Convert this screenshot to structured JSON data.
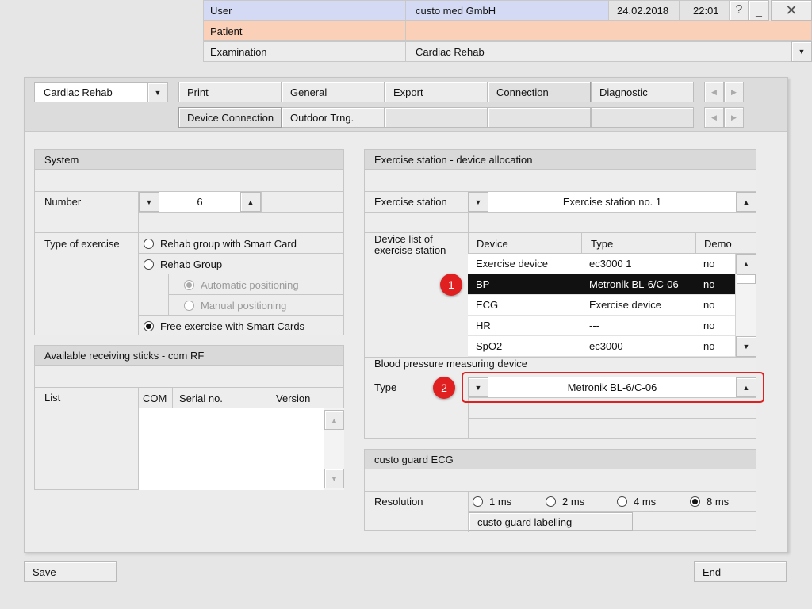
{
  "header": {
    "user_label": "User",
    "user_value": "custo med GmbH",
    "date": "24.02.2018",
    "time": "22:01",
    "help_icon": "question-mark",
    "minimize_icon": "minimize",
    "close_icon": "close-x",
    "patient_label": "Patient",
    "patient_value": "",
    "examination_label": "Examination",
    "examination_value": "Cardiac Rehab",
    "colors": {
      "user_row": "#d4daf3",
      "patient_row": "#fad0b8"
    }
  },
  "toolbar": {
    "module_select": "Cardiac Rehab",
    "tabs_row1": [
      "Print",
      "General",
      "Export",
      "Connection",
      "Diagnostic"
    ],
    "tabs_row2": [
      "Device Connection",
      "Outdoor Trng."
    ],
    "active_tab": "Connection",
    "active_subtab": "Device Connection"
  },
  "system": {
    "title": "System",
    "number_label": "Number",
    "number_value": "6",
    "type_label": "Type of exercise",
    "options": [
      "Rehab group with Smart Card",
      "Rehab Group",
      "Automatic positioning",
      "Manual positioning",
      "Free exercise with Smart Cards"
    ],
    "selected_option": "Free exercise with Smart Cards"
  },
  "sticks": {
    "title": "Available receiving sticks - com RF",
    "list_label": "List",
    "columns": [
      "COM",
      "Serial no.",
      "Version"
    ]
  },
  "allocation": {
    "title": "Exercise station - device allocation",
    "station_label": "Exercise station",
    "station_value": "Exercise station no. 1",
    "device_list_label": "Device list of exercise station",
    "columns": [
      "Device",
      "Type",
      "Demo"
    ],
    "rows": [
      {
        "device": "Exercise device",
        "type": "ec3000 1",
        "demo": "no"
      },
      {
        "device": "BP",
        "type": "Metronik BL-6/C-06",
        "demo": "no"
      },
      {
        "device": "ECG",
        "type": "Exercise device",
        "demo": "no"
      },
      {
        "device": "HR",
        "type": "---",
        "demo": "no"
      },
      {
        "device": "SpO2",
        "type": "ec3000",
        "demo": "no"
      }
    ],
    "selected_row": 1,
    "bp_heading": "Blood pressure measuring device",
    "bp_type_label": "Type",
    "bp_type_value": "Metronik BL-6/C-06"
  },
  "ecg": {
    "title": "custo guard ECG",
    "resolution_label": "Resolution",
    "options": [
      "1 ms",
      "2 ms",
      "4 ms",
      "8 ms"
    ],
    "selected": "8 ms",
    "labelling_button": "custo guard labelling"
  },
  "annotations": {
    "marker1": "1",
    "marker2": "2",
    "highlight_color": "#e02020"
  },
  "footer": {
    "save": "Save",
    "end": "End"
  }
}
